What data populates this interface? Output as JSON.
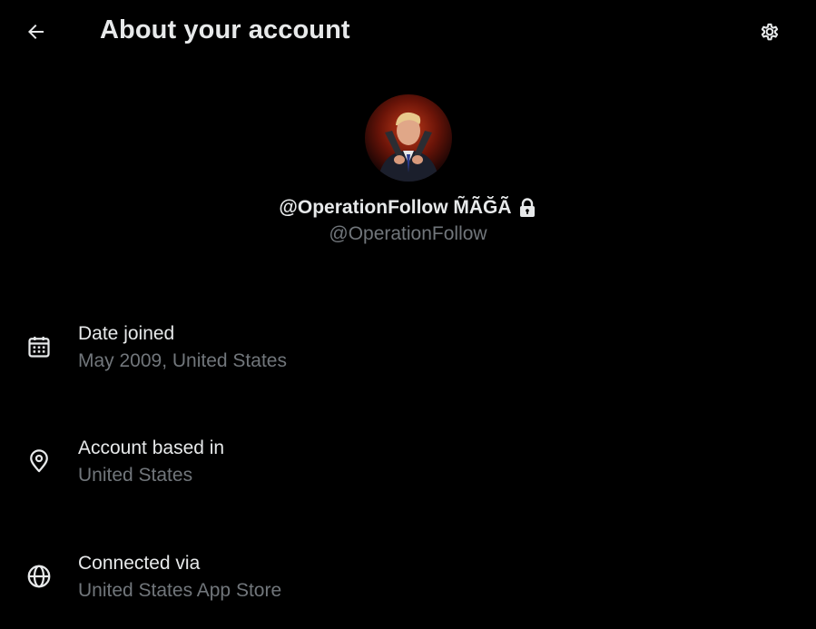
{
  "header": {
    "title": "About your account",
    "back_icon": "arrow-left-icon",
    "settings_icon": "gear-icon"
  },
  "profile": {
    "avatar_icon": "profile-avatar",
    "display_name": "@OperationFollow M̃ÃĞÃ",
    "lock_icon": "lock-icon",
    "handle": "@OperationFollow"
  },
  "info": [
    {
      "icon": "calendar-icon",
      "label": "Date joined",
      "value": "May 2009, United States"
    },
    {
      "icon": "location-pin-icon",
      "label": "Account based in",
      "value": "United States"
    },
    {
      "icon": "globe-icon",
      "label": "Connected via",
      "value": "United States App Store"
    }
  ],
  "colors": {
    "background": "#000000",
    "primary_text": "#e7e9ea",
    "secondary_text": "#71767b"
  }
}
